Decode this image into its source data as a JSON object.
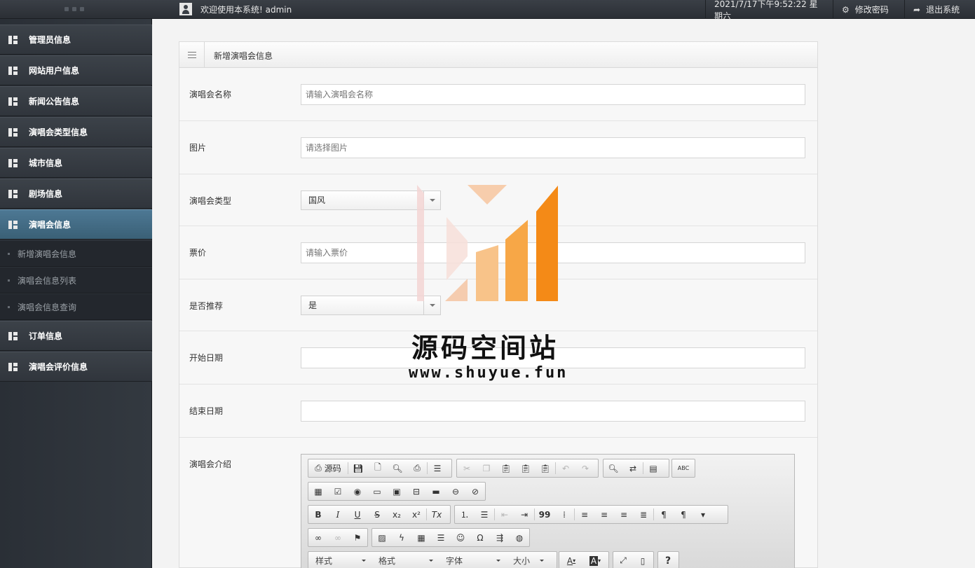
{
  "topbar": {
    "welcome": "欢迎使用本系统! admin",
    "datetime": "2021/7/17下午9:52:22 星期六",
    "change_password": "修改密码",
    "logout": "退出系统"
  },
  "sidebar": {
    "items": [
      {
        "label": "管理员信息"
      },
      {
        "label": "网站用户信息"
      },
      {
        "label": "新闻公告信息"
      },
      {
        "label": "演唱会类型信息"
      },
      {
        "label": "城市信息"
      },
      {
        "label": "剧场信息"
      },
      {
        "label": "演唱会信息"
      },
      {
        "label": "订单信息"
      },
      {
        "label": "演唱会评价信息"
      }
    ],
    "sub_items": [
      {
        "label": "新增演唱会信息"
      },
      {
        "label": "演唱会信息列表"
      },
      {
        "label": "演唱会信息查询"
      }
    ]
  },
  "form": {
    "title": "新增演唱会信息",
    "fields": {
      "name": {
        "label": "演唱会名称",
        "placeholder": "请输入演唱会名称"
      },
      "image": {
        "label": "图片",
        "placeholder": "请选择图片"
      },
      "type": {
        "label": "演唱会类型",
        "value": "国风"
      },
      "price": {
        "label": "票价",
        "placeholder": "请输入票价"
      },
      "recommend": {
        "label": "是否推荐",
        "value": "是"
      },
      "start_date": {
        "label": "开始日期"
      },
      "end_date": {
        "label": "结束日期"
      },
      "intro": {
        "label": "演唱会介绍"
      }
    }
  },
  "editor": {
    "source_label": "源码",
    "combos": {
      "style": "样式",
      "format": "格式",
      "font": "字体",
      "size": "大小"
    },
    "glyphs": {
      "bold": "B",
      "italic": "I",
      "underline": "U",
      "strike": "S",
      "subscript": "x₂",
      "superscript": "x²",
      "remove_format": "Tx",
      "blockquote": "99",
      "special_char": "Ω",
      "help": "?",
      "text_color": "A",
      "bg_color": "A",
      "spell": "ABC"
    }
  },
  "watermark": {
    "cn": "源码空间站",
    "url": "www.shuyue.fun"
  }
}
